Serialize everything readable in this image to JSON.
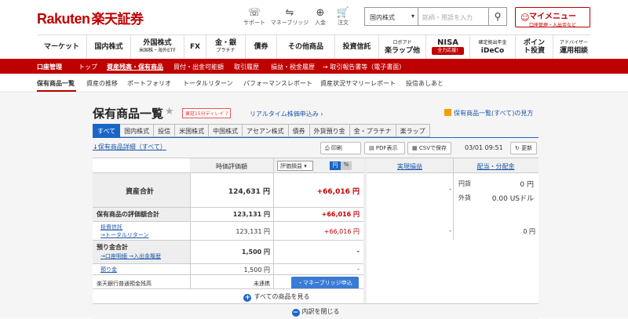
{
  "header": {
    "logo_en": "Rakuten",
    "logo_jp": "楽天証券",
    "icons": [
      {
        "name": "support",
        "label": "サポート"
      },
      {
        "name": "moneybridge",
        "label": "マネーブリッジ"
      },
      {
        "name": "deposit",
        "label": "入金"
      },
      {
        "name": "order",
        "label": "注文"
      }
    ],
    "market_select": "国内株式",
    "search_placeholder": "銘柄・用語を入力",
    "mymenu_title": "マイメニュー",
    "mymenu_sub": "口座管理・入出金など"
  },
  "main_nav": [
    {
      "label": "マーケット",
      "sub": ""
    },
    {
      "label": "国内株式",
      "sub": ""
    },
    {
      "label": "外国株式",
      "sub": "米国株・海外ETF"
    },
    {
      "label": "FX",
      "sub": ""
    },
    {
      "label": "金・銀",
      "sub": "プラチナ"
    },
    {
      "label": "債券",
      "sub": ""
    },
    {
      "label": "その他商品",
      "sub": ""
    },
    {
      "label": "投資信託",
      "sub": ""
    },
    {
      "label": "楽ラップ他",
      "sub": "ロボアド"
    },
    {
      "label": "NISA",
      "sub": "全力応援!"
    },
    {
      "label": "iDeCo",
      "sub": "確定拠出年金"
    },
    {
      "label": "ポイント投資",
      "sub": ""
    },
    {
      "label": "運用相談",
      "sub": "アドバイザー"
    }
  ],
  "red_bar": [
    "口座管理",
    "トップ",
    "資産残高・保有商品",
    "買付・出金可能額",
    "取引履歴",
    "損益・税金履歴",
    "→ 取引報告書等（電子書面）"
  ],
  "sub_nav": [
    "保有商品一覧",
    "資産の推移",
    "ポートフォリオ",
    "トータルリターン",
    "パフォーマンスレポート",
    "資産状況サマリーレポート",
    "投信あしあと"
  ],
  "page": {
    "title": "保有商品一覧",
    "delay_badge": "東証15分ディレイ",
    "realtime_link": "リアルタイム株価申込み",
    "help_link": "保有商品一覧(すべて)の見方",
    "tabs": [
      "すべて",
      "国内株式",
      "投信",
      "米国株式",
      "中国株式",
      "アセアン株式",
      "債券",
      "外貨預り金",
      "金・プラチナ",
      "楽ラップ"
    ],
    "detail_link": "↓保有商品詳細（すべて）",
    "print": "印刷",
    "pdf": "PDF表示",
    "csv": "CSVで保存",
    "updated": "03/01 09:51",
    "refresh": "更新"
  },
  "table": {
    "col_valuation": "時価評価額",
    "col_pl_select": "評価損益",
    "yen": "円",
    "pct": "%",
    "col_realized": "実現損益",
    "col_dividend": "配当・分配金",
    "total_label": "資産合計",
    "total_value": "124,631 円",
    "total_pl": "+66,016 円",
    "realized_dash": "-",
    "div_yen_label": "円貨",
    "div_yen_value": "0 円",
    "div_fx_label": "外貨",
    "div_fx_value": "0.00 USドル",
    "holdings_label": "保有商品の評価額合計",
    "holdings_value": "123,131 円",
    "holdings_pl": "+66,016 円",
    "fund_label": "投資信託",
    "fund_link": "→トータルリターン",
    "fund_value": "123,131 円",
    "fund_pl": "+66,016 円",
    "fund_realized": "-",
    "fund_div": "0 円",
    "deposit_label": "預り金合計",
    "deposit_links": "→口座明細 →入出金履歴",
    "deposit_value": "1,500 円",
    "deposit_pl": "-",
    "azukari_label": "預り金",
    "azukari_value": "1,500 円",
    "azukari_pl": "-",
    "bank_label": "楽天銀行普通預金残高",
    "bank_status": "未連携",
    "bank_button": "・マネーブリッジ申込",
    "show_all": "すべての商品を見る",
    "close_detail": "内訳を閉じる"
  }
}
